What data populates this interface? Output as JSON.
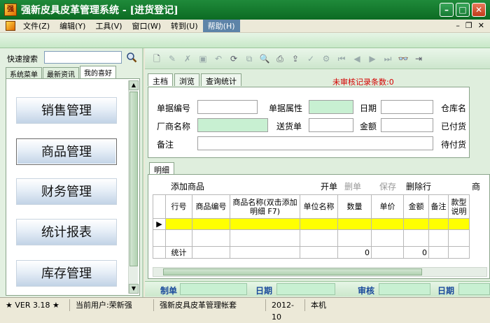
{
  "window": {
    "title": "强新皮具皮革管理系统 - [进货登记]",
    "logo_text": "强"
  },
  "menu": {
    "items": [
      "文件(Z)",
      "编辑(Y)",
      "工具(V)",
      "窗口(W)",
      "转到(U)",
      "帮助(H)"
    ],
    "active_index": 5
  },
  "left_panel": {
    "quick_search_label": "快速搜索",
    "quick_search_value": "",
    "tabs": [
      "系统菜单",
      "最新资讯",
      "我的喜好"
    ],
    "active_tab": 2,
    "buttons": [
      "销售管理",
      "商品管理",
      "财务管理",
      "统计报表",
      "库存管理"
    ],
    "selected_button": 1
  },
  "main_tabs": [
    "主档",
    "浏览",
    "查询统计"
  ],
  "unreviewed_text": "未审核记录条数:0",
  "form": {
    "doc_no_label": "单据编号",
    "doc_attr_label": "单据属性",
    "date_label": "日期",
    "warehouse_label": "仓库名",
    "vendor_label": "厂商名称",
    "delivery_label": "送货单",
    "amount_label": "金额",
    "paid_label": "已付货",
    "remark_label": "备注",
    "unpaid_label": "待付货"
  },
  "detail_tab": "明细",
  "grid_toolbar": {
    "add": "添加商品",
    "open": "开单",
    "delete": "删单",
    "save": "保存",
    "delete_row": "删除行",
    "extra": "商"
  },
  "grid": {
    "headers": [
      "行号",
      "商品编号",
      "商品名称(双击添加明细 F7)",
      "单位名称",
      "数量",
      "单价",
      "金额",
      "备注",
      "款型说明"
    ],
    "total_label": "统计",
    "total_qty": "0",
    "total_amount": "0"
  },
  "footer": {
    "maker_label": "制单",
    "date_label": "日期",
    "review_label": "审核",
    "date2_label": "日期"
  },
  "status": {
    "version": "★ VER 3.18 ★",
    "user": "当前用户:荣新强",
    "account": "强新皮具皮革管理帐套",
    "period": "2012-10",
    "machine": "本机"
  }
}
